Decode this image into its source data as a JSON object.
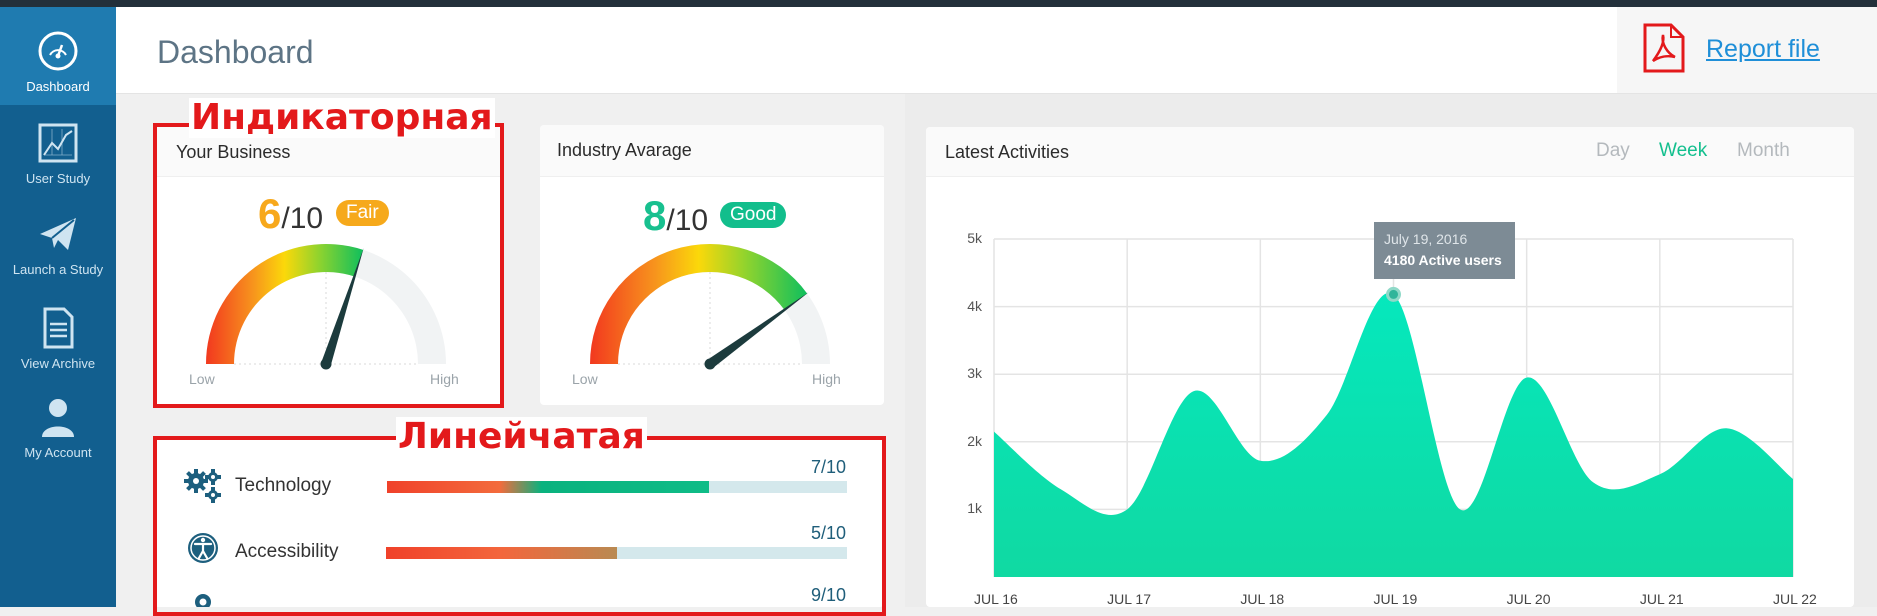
{
  "sidebar": {
    "items": [
      {
        "label": "Dashboard",
        "icon": "dashboard-gauge-icon",
        "active": true
      },
      {
        "label": "User Study",
        "icon": "line-chart-icon",
        "active": false
      },
      {
        "label": "Launch a Study",
        "icon": "paper-plane-icon",
        "active": false
      },
      {
        "label": "View Archive",
        "icon": "document-icon",
        "active": false
      },
      {
        "label": "My Account",
        "icon": "user-icon",
        "active": false
      }
    ]
  },
  "header": {
    "title": "Dashboard",
    "report_label": "Report file",
    "report_icon": "pdf-icon"
  },
  "annotations": {
    "gauge_label": "Индикаторная",
    "bar_label": "Линейчатая"
  },
  "cards": {
    "your_business": {
      "title": "Your Business",
      "score": "6",
      "out_of": "/10",
      "rating": "Fair",
      "level": 0.6,
      "low": "Low",
      "high": "High",
      "score_color": "#f7a81b"
    },
    "industry": {
      "title": "Industry Avarage",
      "score": "8",
      "out_of": "/10",
      "rating": "Good",
      "level": 0.8,
      "low": "Low",
      "high": "High",
      "score_color": "#18c08f"
    }
  },
  "bars": [
    {
      "label": "Technology",
      "score": "7/10",
      "value": 0.7,
      "icon": "gears-icon"
    },
    {
      "label": "Accessibility",
      "score": "5/10",
      "value": 0.5,
      "icon": "accessibility-icon"
    },
    {
      "label": "",
      "score": "9/10",
      "value": 0.9,
      "icon": "location-pin-icon"
    }
  ],
  "activities": {
    "title": "Latest Activities",
    "tabs": [
      {
        "label": "Day",
        "active": false
      },
      {
        "label": "Week",
        "active": true
      },
      {
        "label": "Month",
        "active": false
      }
    ],
    "tooltip": {
      "date": "July 19, 2016",
      "value": "4180 Active users"
    }
  },
  "chart_data": {
    "type": "area",
    "title": "Latest Activities",
    "xlabel": "",
    "ylabel": "",
    "ylim": [
      0,
      5000
    ],
    "grid": true,
    "x_ticks": [
      "JUL 16",
      "JUL 17",
      "JUL 18",
      "JUL 19",
      "JUL 20",
      "JUL 21",
      "JUL 22"
    ],
    "y_ticks": [
      "1k",
      "2k",
      "3k",
      "4k",
      "5k"
    ],
    "series": [
      {
        "x": [
          "JUL 16",
          "JUL 16.5",
          "JUL 17",
          "JUL 17.5",
          "JUL 18",
          "JUL 18.5",
          "JUL 19",
          "JUL 19.5",
          "JUL 20",
          "JUL 20.5",
          "JUL 21",
          "JUL 21.5",
          "JUL 22"
        ],
        "x_pos": [
          0,
          0.5,
          1,
          1.5,
          2,
          2.5,
          3,
          3.5,
          4,
          4.5,
          5,
          5.5,
          6
        ],
        "values": [
          2150,
          1300,
          1000,
          2750,
          1720,
          2400,
          4180,
          1000,
          2950,
          1400,
          1520,
          2200,
          1450
        ]
      }
    ],
    "highlight": {
      "x": "JUL 19",
      "value": 4180
    },
    "fill_color": "#06e3b7"
  }
}
